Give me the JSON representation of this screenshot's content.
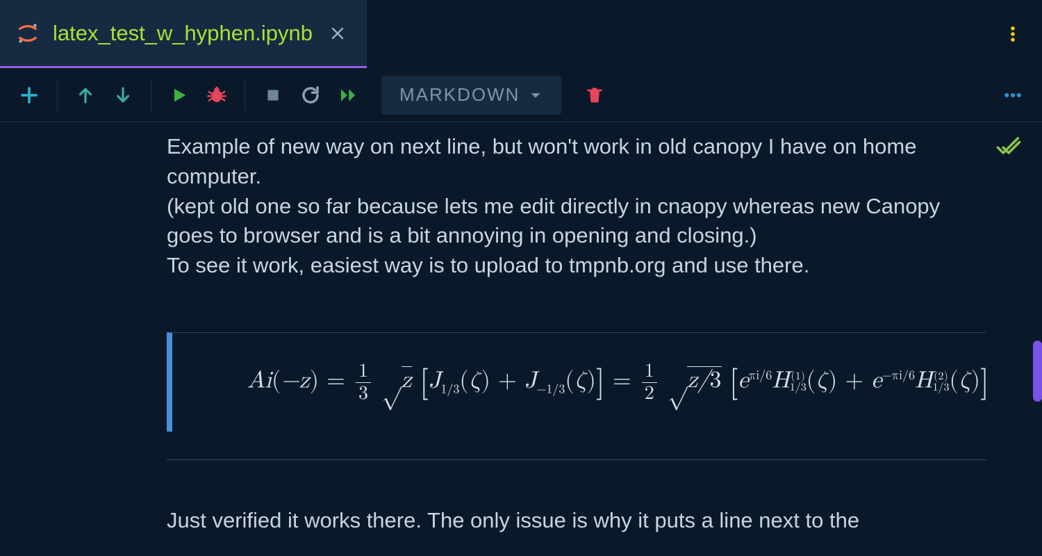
{
  "tab": {
    "label": "latex_test_w_hyphen.ipynb"
  },
  "toolbar": {
    "cell_type": "MARKDOWN"
  },
  "cell": {
    "paragraph1_line1": "Example of new way on next line, but won't work in old canopy I have on home computer.",
    "paragraph1_line2": "(kept old one so far because lets me edit directly in cnaopy whereas new Canopy goes to browser and is a bit annoying in opening and closing.)",
    "paragraph1_line3": "To see it work, easiest way is to upload to tmpnb.org and use there.",
    "equation_latex": "Ai(-z) = \\frac{1}{3} \\sqrt{z} \\left[ J_{1/3}(\\zeta) + J_{-1/3}(\\zeta) \\right] = \\frac{1}{2} \\sqrt{z/3} \\left[ e^{\\pi i/6} H^{(1)}_{1/3}(\\zeta) + e^{-\\pi i/6} H^{(2)}_{1/3}(\\zeta) \\right]",
    "paragraph2_line1": "Just verified it works there. The only issue is why it puts a line next to the"
  }
}
